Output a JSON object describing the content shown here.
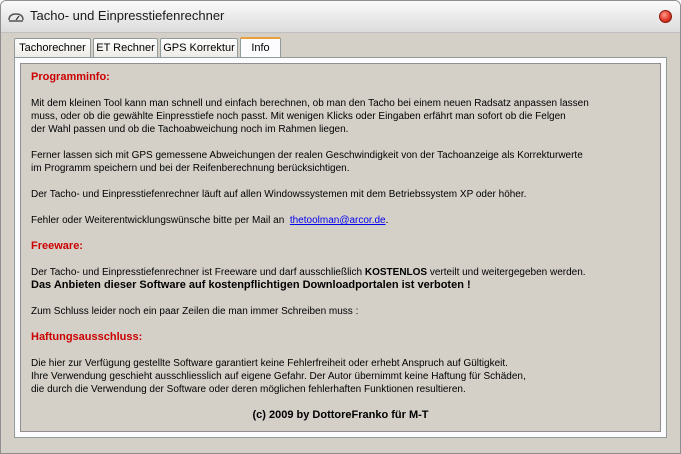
{
  "window": {
    "title": "Tacho- und Einpresstiefenrechner"
  },
  "tabs": [
    "Tachorechner",
    "ET Rechner",
    "GPS Korrektur",
    "Info"
  ],
  "active_tab": "Info",
  "info": {
    "heading1": "Programminfo:",
    "p1_l1": "Mit dem kleinen Tool kann man schnell und einfach berechnen, ob man den Tacho bei einem neuen Radsatz anpassen lassen",
    "p1_l2": "muss, oder ob die gewählte Einpresstiefe noch passt. Mit wenigen Klicks oder Eingaben erfährt man sofort ob die Felgen",
    "p1_l3": "der Wahl passen und ob die Tachoabweichung noch im Rahmen liegen.",
    "p2_l1": "Ferner lassen sich mit GPS gemessene Abweichungen der realen Geschwindigkeit von der Tachoanzeige als Korrekturwerte",
    "p2_l2": "im Programm speichern und bei der Reifenberechnung berücksichtigen.",
    "p3": "Der Tacho- und Einpresstiefenrechner läuft auf allen Windowssystemen mit dem Betriebssystem XP oder höher.",
    "p4_prefix": "Fehler oder Weiterentwicklungswünsche bitte per Mail an",
    "p4_link": "thetoolman@arcor.de",
    "p4_suffix": ".",
    "heading2": "Freeware:",
    "p5_prefix": "Der Tacho- und Einpresstiefenrechner ist Freeware und darf ausschließlich",
    "p5_bold": "KOSTENLOS",
    "p5_suffix": "verteilt und weitergegeben werden.",
    "p6_bold": "Das Anbieten dieser Software auf kostenpflichtigen Downloadportalen ist verboten !",
    "p7": "Zum Schluss leider noch ein paar Zeilen die man immer Schreiben muss :",
    "heading3": "Haftungsausschluss:",
    "p8_l1": "Die hier zur Verfügung gestellte Software garantiert keine Fehlerfreiheit oder erhebt Anspruch auf Gültigkeit.",
    "p8_l2": "Ihre Verwendung geschieht ausschliesslich auf eigene Gefahr. Der Autor übernimmt keine Haftung für Schäden,",
    "p8_l3": "die durch die Verwendung der Software oder deren möglichen fehlerhaften Funktionen resultieren.",
    "footer": "(c) 2009 by DottoreFranko für M-T"
  },
  "colors": {
    "heading": "#cc0000",
    "link": "#0000ee",
    "active_tab_accent": "#e8a03a"
  }
}
